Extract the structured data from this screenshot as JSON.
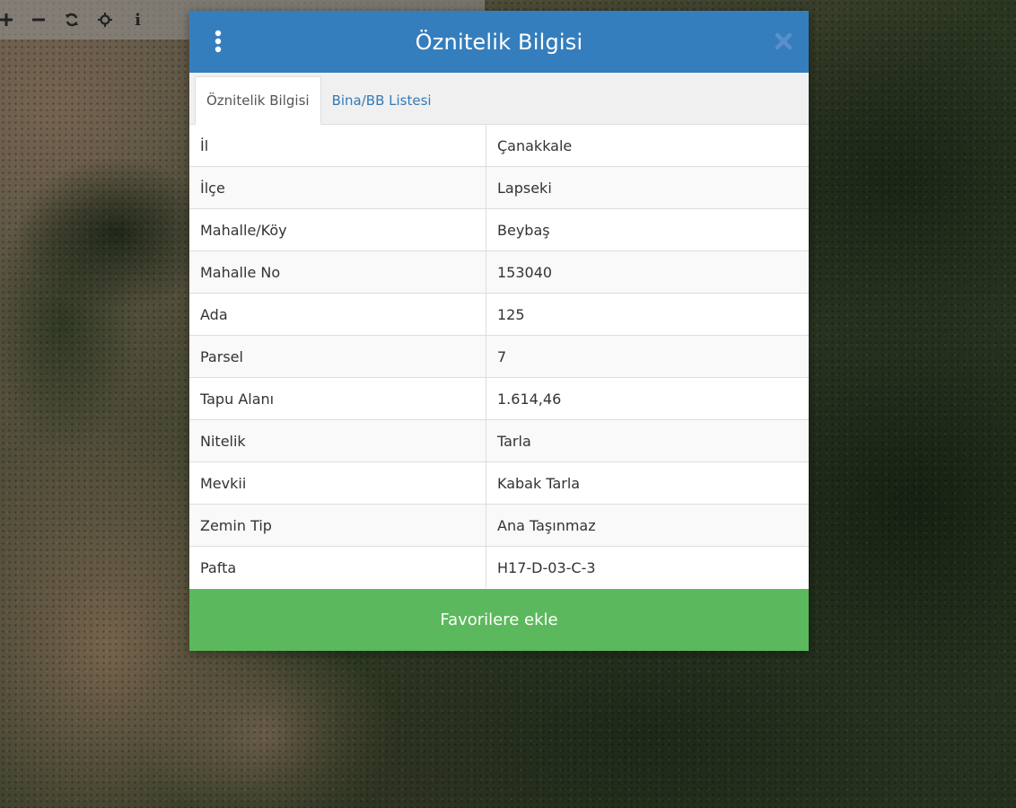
{
  "dialog": {
    "title": "Öznitelik Bilgisi",
    "tabs": [
      {
        "label": "Öznitelik Bilgisi",
        "active": true
      },
      {
        "label": "Bina/BB Listesi",
        "active": false
      }
    ],
    "rows": [
      {
        "key": "İl",
        "value": "Çanakkale"
      },
      {
        "key": "İlçe",
        "value": "Lapseki"
      },
      {
        "key": "Mahalle/Köy",
        "value": "Beybaş"
      },
      {
        "key": "Mahalle No",
        "value": "153040"
      },
      {
        "key": "Ada",
        "value": "125"
      },
      {
        "key": "Parsel",
        "value": "7"
      },
      {
        "key": "Tapu Alanı",
        "value": "1.614,46"
      },
      {
        "key": "Nitelik",
        "value": "Tarla"
      },
      {
        "key": "Mevkii",
        "value": "Kabak Tarla"
      },
      {
        "key": "Zemin Tip",
        "value": "Ana Taşınmaz"
      },
      {
        "key": "Pafta",
        "value": "H17-D-03-C-3"
      }
    ],
    "favorite_button": "Favorilere ekle"
  },
  "toolbar": {
    "icons": [
      "plus-icon",
      "minus-icon",
      "refresh-icon",
      "locate-icon",
      "info-icon"
    ],
    "info_label": "i"
  },
  "colors": {
    "header": "#357ebd",
    "favorite": "#5cb85c",
    "tab_link": "#337ab7"
  }
}
